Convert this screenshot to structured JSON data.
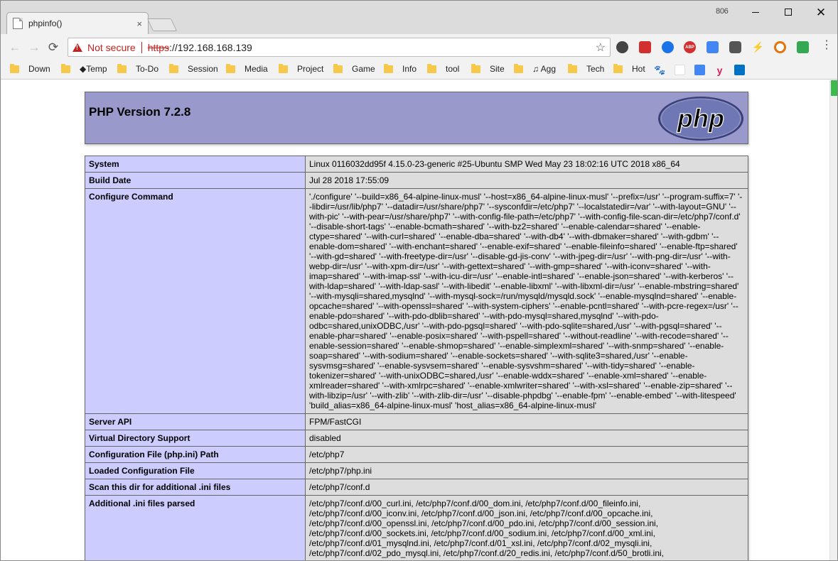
{
  "browser": {
    "tab": {
      "title": "phpinfo()",
      "close": "×"
    },
    "profile_label": "806",
    "window_controls": {
      "close": "✕"
    },
    "nav": {
      "back": "←",
      "forward": "→",
      "reload": "⟳"
    },
    "address": {
      "security_label": "Not secure",
      "scheme": "https",
      "rest": "://192.168.168.139",
      "star": "☆"
    },
    "extensions": [
      "ABP"
    ],
    "menu": "⋮",
    "bookmarks": [
      {
        "label": "Down"
      },
      {
        "label": "◆Temp"
      },
      {
        "label": "To-Do"
      },
      {
        "label": "Session"
      },
      {
        "label": "Media"
      },
      {
        "label": "Project"
      },
      {
        "label": "Game"
      },
      {
        "label": "Info"
      },
      {
        "label": "tool"
      },
      {
        "label": "Site"
      },
      {
        "label": "♫ Agg"
      },
      {
        "label": "Tech"
      },
      {
        "label": "Hot"
      }
    ]
  },
  "phpinfo": {
    "title": "PHP Version 7.2.8",
    "logo_text": "php",
    "rows": [
      {
        "key": "System",
        "value": "Linux 0116032dd95f 4.15.0-23-generic #25-Ubuntu SMP Wed May 23 18:02:16 UTC 2018 x86_64"
      },
      {
        "key": "Build Date",
        "value": "Jul 28 2018 17:55:09"
      },
      {
        "key": "Configure Command",
        "value": "'./configure' '--build=x86_64-alpine-linux-musl' '--host=x86_64-alpine-linux-musl' '--prefix=/usr' '--program-suffix=7' '--libdir=/usr/lib/php7' '--datadir=/usr/share/php7' '--sysconfdir=/etc/php7' '--localstatedir=/var' '--with-layout=GNU' '--with-pic' '--with-pear=/usr/share/php7' '--with-config-file-path=/etc/php7' '--with-config-file-scan-dir=/etc/php7/conf.d' '--disable-short-tags' '--enable-bcmath=shared' '--with-bz2=shared' '--enable-calendar=shared' '--enable-ctype=shared' '--with-curl=shared' '--enable-dba=shared' '--with-db4' '--with-dbmaker=shared' '--with-gdbm' '--enable-dom=shared' '--with-enchant=shared' '--enable-exif=shared' '--enable-fileinfo=shared' '--enable-ftp=shared' '--with-gd=shared' '--with-freetype-dir=/usr' '--disable-gd-jis-conv' '--with-jpeg-dir=/usr' '--with-png-dir=/usr' '--with-webp-dir=/usr' '--with-xpm-dir=/usr' '--with-gettext=shared' '--with-gmp=shared' '--with-iconv=shared' '--with-imap=shared' '--with-imap-ssl' '--with-icu-dir=/usr' '--enable-intl=shared' '--enable-json=shared' '--with-kerberos' '--with-ldap=shared' '--with-ldap-sasl' '--with-libedit' '--enable-libxml' '--with-libxml-dir=/usr' '--enable-mbstring=shared' '--with-mysqli=shared,mysqlnd' '--with-mysql-sock=/run/mysqld/mysqld.sock' '--enable-mysqlnd=shared' '--enable-opcache=shared' '--with-openssl=shared' '--with-system-ciphers' '--enable-pcntl=shared' '--with-pcre-regex=/usr' '--enable-pdo=shared' '--with-pdo-dblib=shared' '--with-pdo-mysql=shared,mysqlnd' '--with-pdo-odbc=shared,unixODBC,/usr' '--with-pdo-pgsql=shared' '--with-pdo-sqlite=shared,/usr' '--with-pgsql=shared' '--enable-phar=shared' '--enable-posix=shared' '--with-pspell=shared' '--without-readline' '--with-recode=shared' '--enable-session=shared' '--enable-shmop=shared' '--enable-simplexml=shared' '--with-snmp=shared' '--enable-soap=shared' '--with-sodium=shared' '--enable-sockets=shared' '--with-sqlite3=shared,/usr' '--enable-sysvmsg=shared' '--enable-sysvsem=shared' '--enable-sysvshm=shared' '--with-tidy=shared' '--enable-tokenizer=shared' '--with-unixODBC=shared,/usr' '--enable-wddx=shared' '--enable-xml=shared' '--enable-xmlreader=shared' '--with-xmlrpc=shared' '--enable-xmlwriter=shared' '--with-xsl=shared' '--enable-zip=shared' '--with-libzip=/usr' '--with-zlib' '--with-zlib-dir=/usr' '--disable-phpdbg' '--enable-fpm' '--enable-embed' '--with-litespeed' 'build_alias=x86_64-alpine-linux-musl' 'host_alias=x86_64-alpine-linux-musl'"
      },
      {
        "key": "Server API",
        "value": "FPM/FastCGI"
      },
      {
        "key": "Virtual Directory Support",
        "value": "disabled"
      },
      {
        "key": "Configuration File (php.ini) Path",
        "value": "/etc/php7"
      },
      {
        "key": "Loaded Configuration File",
        "value": "/etc/php7/php.ini"
      },
      {
        "key": "Scan this dir for additional .ini files",
        "value": "/etc/php7/conf.d"
      },
      {
        "key": "Additional .ini files parsed",
        "value": "/etc/php7/conf.d/00_curl.ini, /etc/php7/conf.d/00_dom.ini, /etc/php7/conf.d/00_fileinfo.ini, /etc/php7/conf.d/00_iconv.ini, /etc/php7/conf.d/00_json.ini, /etc/php7/conf.d/00_opcache.ini, /etc/php7/conf.d/00_openssl.ini, /etc/php7/conf.d/00_pdo.ini, /etc/php7/conf.d/00_session.ini, /etc/php7/conf.d/00_sockets.ini, /etc/php7/conf.d/00_sodium.ini, /etc/php7/conf.d/00_xml.ini, /etc/php7/conf.d/01_mysqlnd.ini, /etc/php7/conf.d/01_xsl.ini, /etc/php7/conf.d/02_mysqli.ini, /etc/php7/conf.d/02_pdo_mysql.ini, /etc/php7/conf.d/20_redis.ini, /etc/php7/conf.d/50_brotli.ini,"
      }
    ]
  },
  "colors": {
    "header_bg": "#9999cc",
    "key_bg": "#ccccff",
    "value_bg": "#dddddd",
    "not_secure": "#c5221f"
  }
}
